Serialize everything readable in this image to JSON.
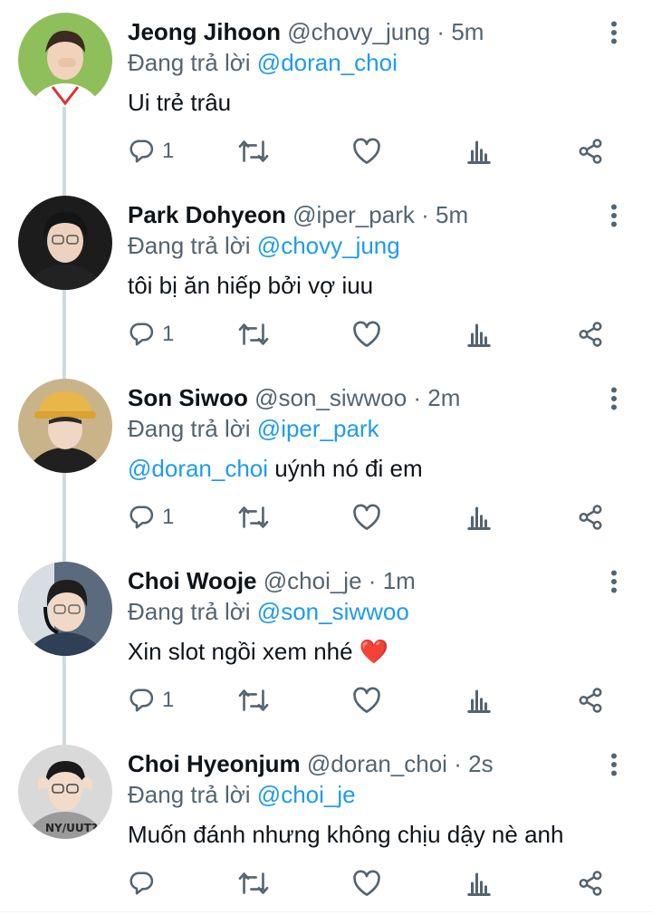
{
  "tweets": [
    {
      "name": "Jeong Jihoon",
      "handle": "@chovy_jung",
      "time": "5m",
      "replying_prefix": "Đang trả lời",
      "replying_to": "@doran_choi",
      "text_mention": "",
      "text": "Ui trẻ trâu",
      "reply_count": "1",
      "avatar_bg": "#8fbf5a",
      "shirt": "#ffffff"
    },
    {
      "name": "Park Dohyeon",
      "handle": "@iper_park",
      "time": "5m",
      "replying_prefix": "Đang trả lời",
      "replying_to": "@chovy_jung",
      "text_mention": "",
      "text": "tôi bị ăn hiếp bởi vợ iuu",
      "reply_count": "1",
      "avatar_bg": "#1c1c1c",
      "shirt": "#222222"
    },
    {
      "name": "Son Siwoo",
      "handle": "@son_siwwoo",
      "time": "2m",
      "replying_prefix": "Đang trả lời",
      "replying_to": "@iper_park",
      "text_mention": "@doran_choi",
      "text": " uýnh nó đi em",
      "reply_count": "1",
      "avatar_bg": "#c9b48a",
      "shirt": "#202020"
    },
    {
      "name": "Choi Wooje",
      "handle": "@choi_je",
      "time": "1m",
      "replying_prefix": "Đang trả lời",
      "replying_to": "@son_siwwoo",
      "text_mention": "",
      "text": "Xin slot ngồi xem nhé ❤️",
      "reply_count": "1",
      "avatar_bg": "#5b6b7d",
      "shirt": "#2f3f55"
    },
    {
      "name": "Choi Hyeonjum",
      "handle": "@doran_choi",
      "time": "2s",
      "replying_prefix": "Đang trả lời",
      "replying_to": "@choi_je",
      "text_mention": "",
      "text": "Muốn đánh nhưng không chịu dậy nè anh",
      "reply_count": "",
      "avatar_bg": "#d9d9d9",
      "shirt": "#9a9a9a"
    }
  ],
  "colors": {
    "accent": "#1d9bf0",
    "secondary_text": "#536471",
    "thread_line": "#cfd9de"
  }
}
